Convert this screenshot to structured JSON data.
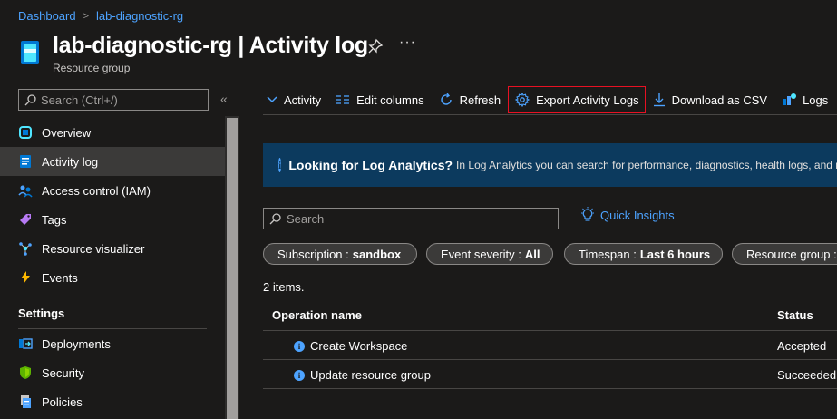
{
  "breadcrumb": {
    "home": "Dashboard",
    "current": "lab-diagnostic-rg",
    "separator": ">"
  },
  "header": {
    "title": "lab-diagnostic-rg | Activity log",
    "subtitle": "Resource group",
    "more": "···"
  },
  "sidebar": {
    "search_placeholder": "Search (Ctrl+/)",
    "collapse": "«",
    "items": [
      {
        "label": "Overview",
        "icon": "overview-icon",
        "color": "#50e6ff"
      },
      {
        "label": "Activity log",
        "icon": "activity-log-icon",
        "color": "#0078d4",
        "active": true
      },
      {
        "label": "Access control (IAM)",
        "icon": "people-icon",
        "color": "#4da3ff"
      },
      {
        "label": "Tags",
        "icon": "tag-icon",
        "color": "#b77af4"
      },
      {
        "label": "Resource visualizer",
        "icon": "visualizer-icon",
        "color": "#50e6ff"
      },
      {
        "label": "Events",
        "icon": "lightning-icon",
        "color": "#ffb900"
      }
    ],
    "section_title": "Settings",
    "settings_items": [
      {
        "label": "Deployments",
        "icon": "deployments-icon",
        "color": "#4da3ff"
      },
      {
        "label": "Security",
        "icon": "shield-icon",
        "color": "#5db300"
      },
      {
        "label": "Policies",
        "icon": "policies-icon",
        "color": "#4da3ff"
      }
    ]
  },
  "toolbar": {
    "activity": "Activity",
    "edit_columns": "Edit columns",
    "refresh": "Refresh",
    "export": "Export Activity Logs",
    "download": "Download as CSV",
    "logs": "Logs"
  },
  "banner": {
    "bold": "Looking for Log Analytics?",
    "text": "In Log Analytics you can search for performance, diagnostics, health logs, and m"
  },
  "main": {
    "search_placeholder": "Search",
    "quick_insights": "Quick Insights",
    "filters": [
      {
        "key": "Subscription : ",
        "value": "sandbox"
      },
      {
        "key": "Event severity : ",
        "value": "All"
      },
      {
        "key": "Timespan : ",
        "value": "Last 6 hours"
      },
      {
        "key": "Resource group : ",
        "value": ""
      }
    ],
    "item_count": "2 items.",
    "columns": {
      "operation": "Operation name",
      "status": "Status"
    },
    "rows": [
      {
        "operation": "Create Workspace",
        "status": "Accepted"
      },
      {
        "operation": "Update resource group",
        "status": "Succeeded"
      }
    ]
  },
  "colors": {
    "accent": "#4da3ff",
    "highlight_border": "#e81123",
    "banner_bg": "#0c3a5e"
  }
}
